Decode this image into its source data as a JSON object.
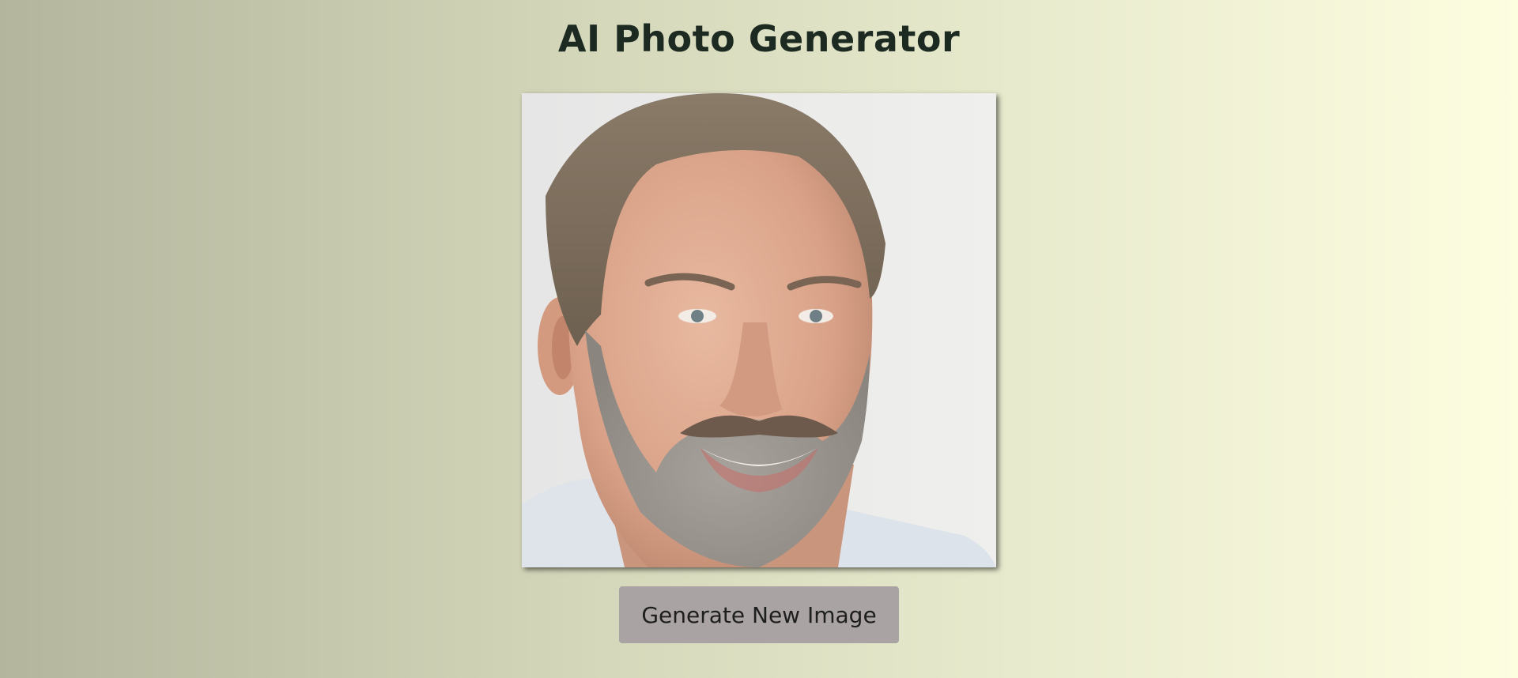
{
  "page": {
    "title": "AI Photo Generator"
  },
  "image": {
    "subject": "generated-portrait-photo"
  },
  "controls": {
    "generate_label": "Generate New Image"
  },
  "colors": {
    "background_left": "#b3b59d",
    "background_right": "#fdfde0",
    "title_text": "#1c2a22",
    "button_bg": "#a9a3a3",
    "button_text": "#1e1e1e"
  }
}
